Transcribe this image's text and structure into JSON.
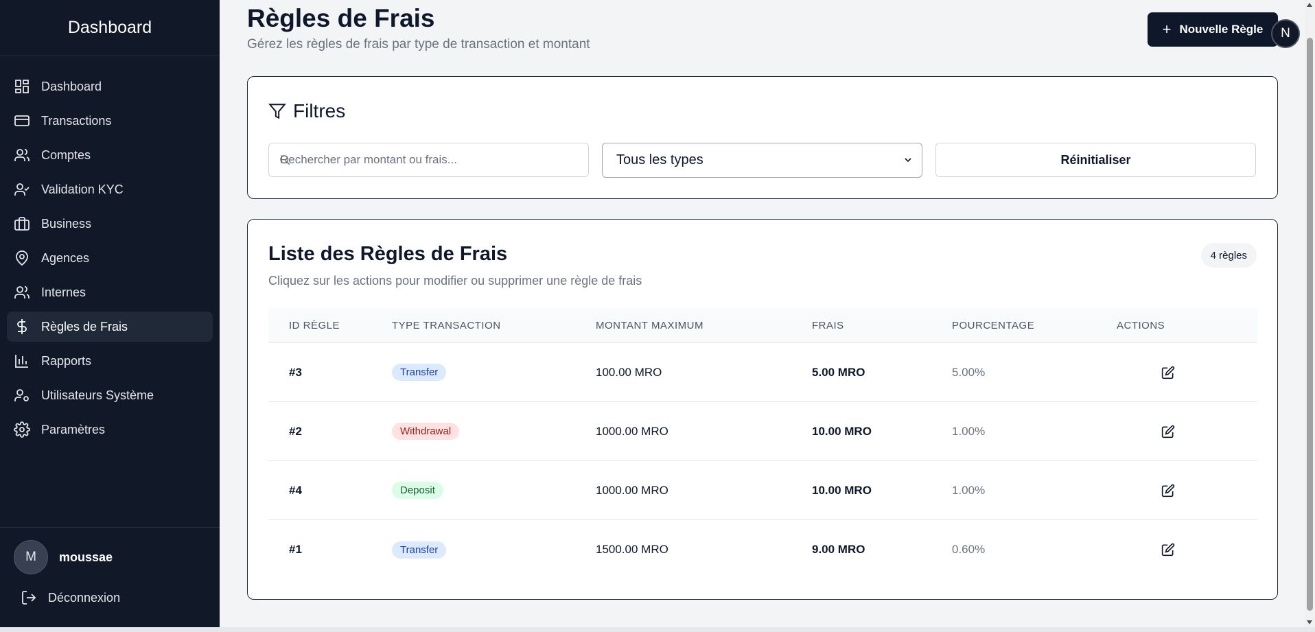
{
  "sidebar": {
    "title": "Dashboard",
    "items": [
      {
        "label": "Dashboard",
        "icon": "dashboard-icon"
      },
      {
        "label": "Transactions",
        "icon": "credit-card-icon"
      },
      {
        "label": "Comptes",
        "icon": "users-icon"
      },
      {
        "label": "Validation KYC",
        "icon": "user-check-icon"
      },
      {
        "label": "Business",
        "icon": "briefcase-icon"
      },
      {
        "label": "Agences",
        "icon": "map-pin-icon"
      },
      {
        "label": "Internes",
        "icon": "users-icon"
      },
      {
        "label": "Règles de Frais",
        "icon": "dollar-icon"
      },
      {
        "label": "Rapports",
        "icon": "bar-chart-icon"
      },
      {
        "label": "Utilisateurs Système",
        "icon": "user-cog-icon"
      },
      {
        "label": "Paramètres",
        "icon": "settings-icon"
      }
    ],
    "active_index": 7,
    "user": {
      "initial": "M",
      "name": "moussae"
    },
    "logout_label": "Déconnexion"
  },
  "header": {
    "title": "Règles de Frais",
    "subtitle": "Gérez les règles de frais par type de transaction et montant",
    "new_button": "Nouvelle Règle",
    "avatar_initial": "N"
  },
  "filters": {
    "title": "Filtres",
    "search_placeholder": "Rechercher par montant ou frais...",
    "type_selected": "Tous les types",
    "reset_label": "Réinitialiser"
  },
  "rules": {
    "title": "Liste des Règles de Frais",
    "subtitle": "Cliquez sur les actions pour modifier ou supprimer une règle de frais",
    "count_label": "4 règles",
    "columns": [
      "ID RÈGLE",
      "TYPE TRANSACTION",
      "MONTANT MAXIMUM",
      "FRAIS",
      "POURCENTAGE",
      "ACTIONS"
    ],
    "rows": [
      {
        "id": "#3",
        "type": "Transfer",
        "max": "100.00 MRO",
        "fee": "5.00 MRO",
        "pct": "5.00%"
      },
      {
        "id": "#2",
        "type": "Withdrawal",
        "max": "1000.00 MRO",
        "fee": "10.00 MRO",
        "pct": "1.00%"
      },
      {
        "id": "#4",
        "type": "Deposit",
        "max": "1000.00 MRO",
        "fee": "10.00 MRO",
        "pct": "1.00%"
      },
      {
        "id": "#1",
        "type": "Transfer",
        "max": "1500.00 MRO",
        "fee": "9.00 MRO",
        "pct": "0.60%"
      }
    ]
  },
  "colors": {
    "sidebar_bg": "#111827",
    "primary_button": "#0f172a",
    "transfer_badge": "#dbeafe",
    "withdrawal_badge": "#fee2e2",
    "deposit_badge": "#dcfce7"
  }
}
